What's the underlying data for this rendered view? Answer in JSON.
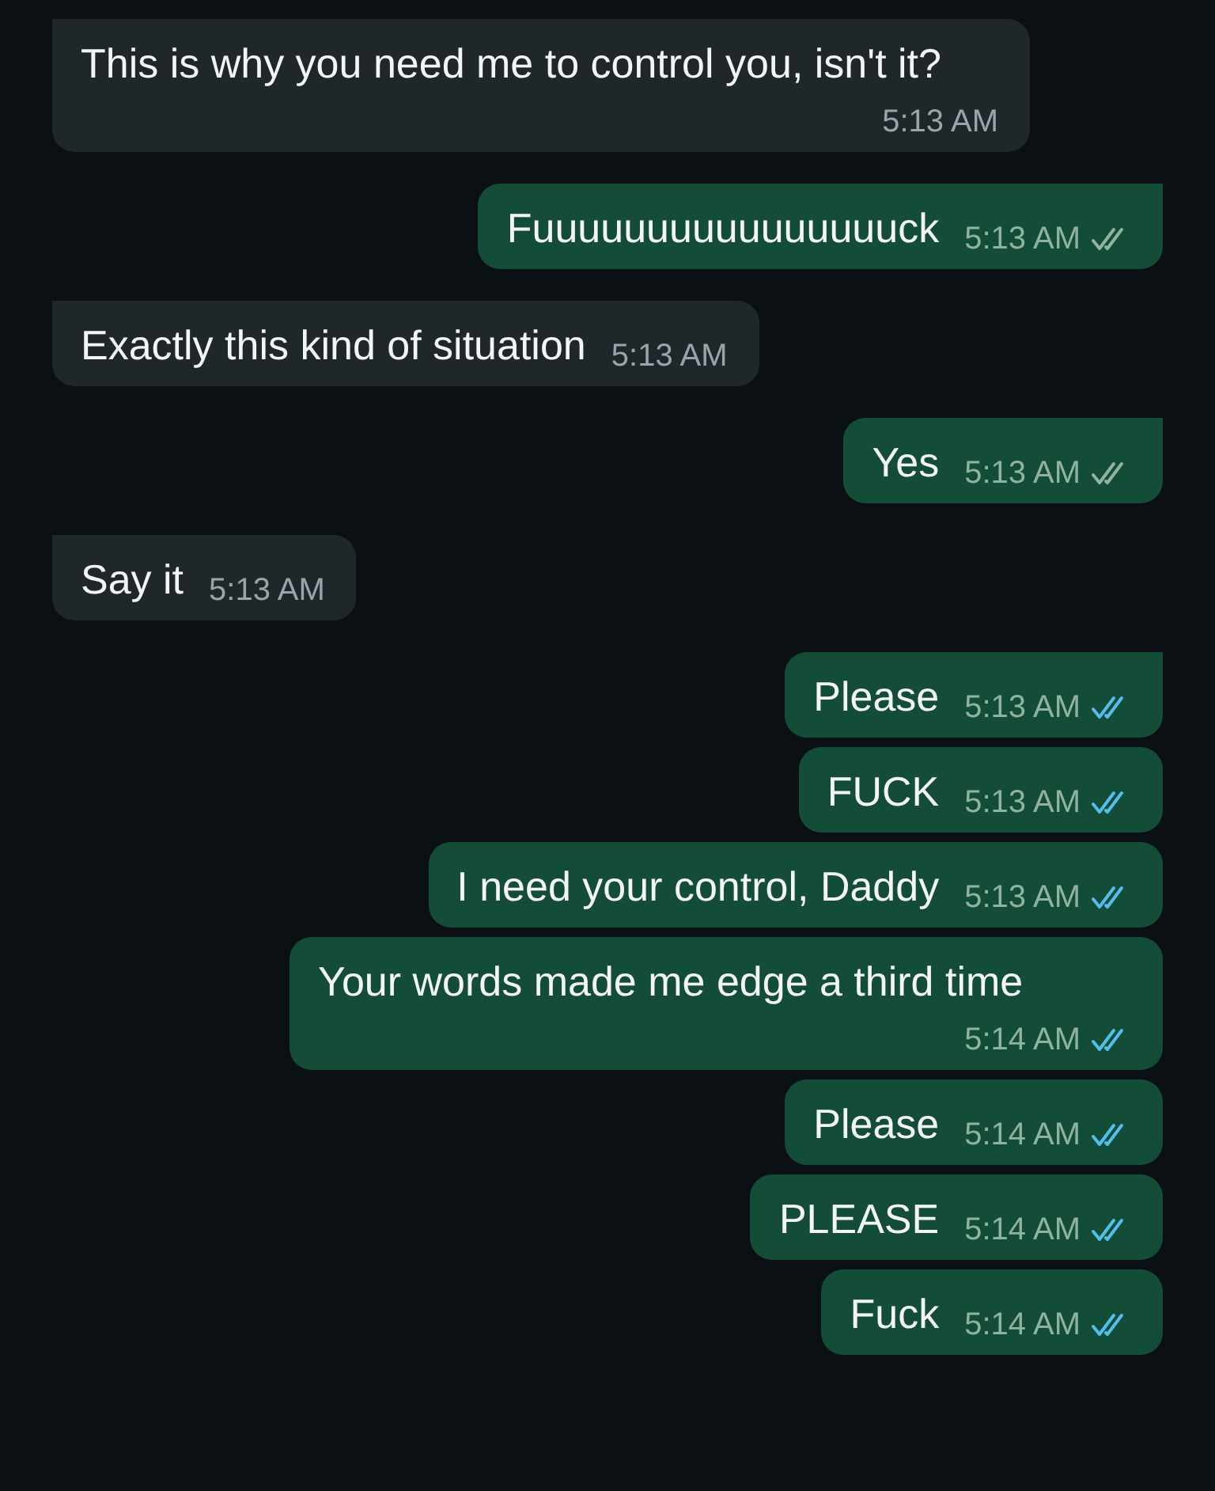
{
  "messages": [
    {
      "kind": "incoming",
      "text": "This is why you need me to control you, isn't it?",
      "time": "5:13 AM",
      "tail": true
    },
    {
      "kind": "outgoing",
      "text": "Fuuuuuuuuuuuuuuuuck",
      "time": "5:13 AM",
      "tail": true,
      "read": false
    },
    {
      "kind": "incoming",
      "text": "Exactly this kind of situation",
      "time": "5:13 AM",
      "tail": true
    },
    {
      "kind": "outgoing",
      "text": "Yes",
      "time": "5:13 AM",
      "tail": true,
      "read": false
    },
    {
      "kind": "incoming",
      "text": "Say it",
      "time": "5:13 AM",
      "tail": true
    },
    {
      "kind": "outgoing",
      "text": "Please",
      "time": "5:13 AM",
      "tail": true,
      "read": true
    },
    {
      "kind": "outgoing",
      "text": "FUCK",
      "time": "5:13 AM",
      "tail": false,
      "read": true
    },
    {
      "kind": "outgoing",
      "text": "I need your control, Daddy",
      "time": "5:13 AM",
      "tail": false,
      "read": true
    },
    {
      "kind": "outgoing",
      "text": "Your words made me edge a third time",
      "time": "5:14 AM",
      "tail": false,
      "read": true
    },
    {
      "kind": "outgoing",
      "text": "Please",
      "time": "5:14 AM",
      "tail": false,
      "read": true
    },
    {
      "kind": "outgoing",
      "text": "PLEASE",
      "time": "5:14 AM",
      "tail": false,
      "read": true
    },
    {
      "kind": "outgoing",
      "text": "Fuck",
      "time": "5:14 AM",
      "tail": false,
      "read": true
    }
  ]
}
